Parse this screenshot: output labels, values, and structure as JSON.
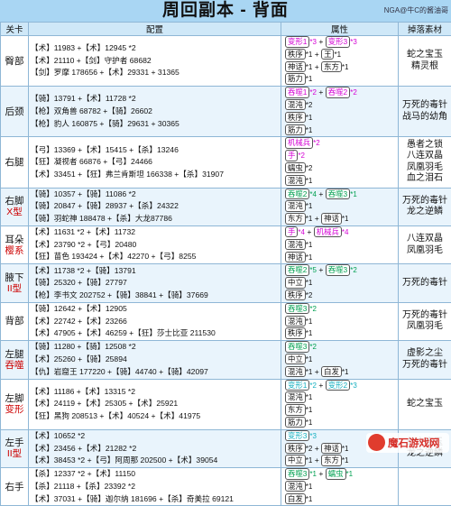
{
  "header": {
    "title": "周回副本 - 背面",
    "credit": "NGA@牛C的酱油哥"
  },
  "columns": [
    "关卡",
    "配置",
    "属性",
    "掉落素材"
  ],
  "colors": {
    "header_bg": "#a9d6f3",
    "grid": "#8fb7d6",
    "magenta": "#d400d4",
    "green": "#00a050",
    "teal": "#16b0c0",
    "tag_red": "#cc0000"
  },
  "rows": [
    {
      "pos": "臀部",
      "tag": "",
      "config": [
        "【术】11983 +【术】12945 *2",
        "【术】21110 +【剑】守护者 68682",
        "【剑】罗摩 178656 +【术】29331 + 31365"
      ],
      "attrs": [
        [
          {
            "t": "变形1",
            "c": "#d400d4"
          },
          {
            "t": "*3",
            "c": "#d400d4"
          },
          {
            "t": "变形3",
            "c": "#d400d4"
          },
          {
            "t": "*3",
            "c": "#d400d4"
          }
        ],
        [
          {
            "t": "秩序",
            "c": "#111"
          },
          {
            "t": "*1",
            "c": "#111"
          },
          {
            "t": "王",
            "c": "#111"
          },
          {
            "t": "*1",
            "c": "#111"
          }
        ],
        [
          {
            "t": "神话",
            "c": "#111"
          },
          {
            "t": "*1",
            "c": "#111"
          },
          {
            "t": "东方",
            "c": "#111"
          },
          {
            "t": "*1",
            "c": "#111"
          }
        ],
        [
          {
            "t": "筋力",
            "c": "#111"
          },
          {
            "t": "*1",
            "c": "#111"
          }
        ]
      ],
      "drops": [
        "蛇之宝玉",
        "精灵根"
      ]
    },
    {
      "pos": "后颈",
      "tag": "",
      "config": [
        "【骑】13791 +【术】11728 *2",
        "【枪】双角兽 68782 +【骑】26602",
        "【枪】豹人 160875 +【骑】29631 + 30365"
      ],
      "attrs": [
        [
          {
            "t": "吞噬1",
            "c": "#d400d4"
          },
          {
            "t": "*2",
            "c": "#d400d4"
          },
          {
            "t": "吞噬2",
            "c": "#d400d4"
          },
          {
            "t": "*2",
            "c": "#d400d4"
          }
        ],
        [
          {
            "t": "混沌",
            "c": "#111"
          },
          {
            "t": "*2",
            "c": "#111"
          }
        ],
        [
          {
            "t": "秩序",
            "c": "#111"
          },
          {
            "t": "*1",
            "c": "#111"
          }
        ],
        [
          {
            "t": "筋力",
            "c": "#111"
          },
          {
            "t": "*1",
            "c": "#111"
          }
        ]
      ],
      "drops": [
        "万死的毒针",
        "战马的幼角"
      ]
    },
    {
      "pos": "右腿",
      "tag": "",
      "config": [
        "【弓】13369 +【术】15415 +【杀】13246",
        "【狂】凝视者 66876 +【弓】24466",
        "【术】33451 +【狂】弗兰肯斯坦 166338 +【杀】31907"
      ],
      "attrs": [
        [
          {
            "t": "机械兵",
            "c": "#d400d4"
          },
          {
            "t": "*2",
            "c": "#d400d4"
          }
        ],
        [
          {
            "t": "手",
            "c": "#d400d4"
          },
          {
            "t": "*2",
            "c": "#d400d4"
          }
        ],
        [
          {
            "t": "蠕虫",
            "c": "#111"
          },
          {
            "t": "*2",
            "c": "#111"
          }
        ],
        [
          {
            "t": "混沌",
            "c": "#111"
          },
          {
            "t": "*1",
            "c": "#111"
          }
        ]
      ],
      "drops": [
        "愚者之锁",
        "八连双晶",
        "凤凰羽毛",
        "血之泪石"
      ]
    },
    {
      "pos": "右脚",
      "tag": "X型",
      "config": [
        "【骑】10357 +【骑】11086 *2",
        "【骑】20847 +【骑】28937 +【杀】24322",
        "【骑】羽蛇神 188478 +【杀】大龙87786"
      ],
      "attrs": [
        [
          {
            "t": "吞噬2",
            "c": "#00a050"
          },
          {
            "t": "*4",
            "c": "#00a050"
          },
          {
            "t": "吞噬3",
            "c": "#00a050"
          },
          {
            "t": "*1",
            "c": "#00a050"
          }
        ],
        [
          {
            "t": "混沌",
            "c": "#111"
          },
          {
            "t": "*1",
            "c": "#111"
          }
        ],
        [
          {
            "t": "东方",
            "c": "#111"
          },
          {
            "t": "*1",
            "c": "#111"
          },
          {
            "t": "神话",
            "c": "#111"
          },
          {
            "t": "*1",
            "c": "#111"
          }
        ]
      ],
      "drops": [
        "万死的毒针",
        "龙之逆鳞"
      ]
    },
    {
      "pos": "耳朵",
      "tag": "樱系",
      "config": [
        "【术】11631 *2 +【术】11732",
        "【术】23790 *2 +【弓】20480",
        "【狂】苗色 193424 +【术】42270 +【弓】8255"
      ],
      "attrs": [
        [
          {
            "t": "手",
            "c": "#d400d4"
          },
          {
            "t": "*4",
            "c": "#d400d4"
          },
          {
            "t": "机械兵",
            "c": "#d400d4"
          },
          {
            "t": "*4",
            "c": "#d400d4"
          }
        ],
        [
          {
            "t": "混沌",
            "c": "#111"
          },
          {
            "t": "*1",
            "c": "#111"
          }
        ],
        [
          {
            "t": "神话",
            "c": "#111"
          },
          {
            "t": "*1",
            "c": "#111"
          }
        ]
      ],
      "drops": [
        "八连双晶",
        "凤凰羽毛"
      ]
    },
    {
      "pos": "腋下",
      "tag": "II型",
      "config": [
        "【术】11738 *2 +【骑】13791",
        "【骑】25320 +【骑】27797",
        "【枪】李书文 202752 +【骑】38841 +【骑】37669"
      ],
      "attrs": [
        [
          {
            "t": "吞噬2",
            "c": "#00a050"
          },
          {
            "t": "*5",
            "c": "#00a050"
          },
          {
            "t": "吞噬3",
            "c": "#00a050"
          },
          {
            "t": "*2",
            "c": "#00a050"
          }
        ],
        [
          {
            "t": "中立",
            "c": "#111"
          },
          {
            "t": "*1",
            "c": "#111"
          }
        ],
        [
          {
            "t": "秩序",
            "c": "#111"
          },
          {
            "t": "*2",
            "c": "#111"
          }
        ]
      ],
      "drops": [
        "万死的毒针"
      ]
    },
    {
      "pos": "背部",
      "tag": "",
      "config": [
        "【骑】12642 +【术】12905",
        "【术】22742 +【术】23266",
        "【术】47905 +【术】46259 +【狂】莎士比亚 211530"
      ],
      "attrs": [
        [
          {
            "t": "吞噬3",
            "c": "#00a050"
          },
          {
            "t": "*2",
            "c": "#00a050"
          }
        ],
        [
          {
            "t": "混沌",
            "c": "#111"
          },
          {
            "t": "*1",
            "c": "#111"
          }
        ],
        [
          {
            "t": "秩序",
            "c": "#111"
          },
          {
            "t": "*1",
            "c": "#111"
          }
        ]
      ],
      "drops": [
        "万死的毒针",
        "凤凰羽毛"
      ]
    },
    {
      "pos": "左腿",
      "tag": "吞噬",
      "config": [
        "【骑】11280 +【骑】12508 *2",
        "【术】25260 +【骑】25894",
        "【仇】岩窟王 177220 +【骑】44740 +【骑】42097"
      ],
      "attrs": [
        [
          {
            "t": "吞噬3",
            "c": "#00a050"
          },
          {
            "t": "*2",
            "c": "#00a050"
          }
        ],
        [
          {
            "t": "中立",
            "c": "#111"
          },
          {
            "t": "*1",
            "c": "#111"
          }
        ],
        [
          {
            "t": "混沌",
            "c": "#111"
          },
          {
            "t": "*1",
            "c": "#111"
          },
          {
            "t": "白发",
            "c": "#111"
          },
          {
            "t": "*1",
            "c": "#111"
          }
        ]
      ],
      "drops": [
        "虚影之尘",
        "万死的毒针"
      ]
    },
    {
      "pos": "左脚",
      "tag": "变形",
      "config": [
        "【术】11186 +【术】13315 *2",
        "【术】24119 +【术】25305 +【术】25921",
        "【狂】黑狗 208513 +【术】40524 +【术】41975"
      ],
      "attrs": [
        [
          {
            "t": "变形1",
            "c": "#16b0c0"
          },
          {
            "t": "*2",
            "c": "#16b0c0"
          },
          {
            "t": "变形2",
            "c": "#16b0c0"
          },
          {
            "t": "*3",
            "c": "#16b0c0"
          }
        ],
        [
          {
            "t": "混沌",
            "c": "#111"
          },
          {
            "t": "*1",
            "c": "#111"
          }
        ],
        [
          {
            "t": "东方",
            "c": "#111"
          },
          {
            "t": "*1",
            "c": "#111"
          }
        ],
        [
          {
            "t": "筋力",
            "c": "#111"
          },
          {
            "t": "*1",
            "c": "#111"
          }
        ]
      ],
      "drops": [
        "蛇之宝玉"
      ]
    },
    {
      "pos": "左手",
      "tag": "II型",
      "config": [
        "【术】10652 *2",
        "【术】23456 +【术】21282 *2",
        "【术】38453 *2 +【弓】阿周那 202500 +【术】39054"
      ],
      "attrs": [
        [
          {
            "t": "变形3",
            "c": "#16b0c0"
          },
          {
            "t": "*3",
            "c": "#16b0c0"
          }
        ],
        [
          {
            "t": "秩序",
            "c": "#111"
          },
          {
            "t": "*2",
            "c": "#111"
          },
          {
            "t": "神话",
            "c": "#111"
          },
          {
            "t": "*1",
            "c": "#111"
          }
        ],
        [
          {
            "t": "中立",
            "c": "#111"
          },
          {
            "t": "*1",
            "c": "#111"
          },
          {
            "t": "东方",
            "c": "#111"
          },
          {
            "t": "*1",
            "c": "#111"
          }
        ]
      ],
      "drops": [
        "蛇之宝玉",
        "龙之逆鳞"
      ]
    },
    {
      "pos": "右手",
      "tag": "",
      "config": [
        "【杀】12337 *2 +【术】11150",
        "【杀】21118 +【杀】23392 *2",
        "【术】37031 +【骑】迦尔纳 181696 +【杀】奇美拉 69121"
      ],
      "attrs": [
        [
          {
            "t": "吞噬3",
            "c": "#00a050"
          },
          {
            "t": "*1",
            "c": "#00a050"
          },
          {
            "t": "蠕虫",
            "c": "#00a050"
          },
          {
            "t": "*1",
            "c": "#00a050"
          }
        ],
        [
          {
            "t": "混沌",
            "c": "#111"
          },
          {
            "t": "*1",
            "c": "#111"
          }
        ],
        [
          {
            "t": "白发",
            "c": "#111"
          },
          {
            "t": "*1",
            "c": "#111"
          }
        ]
      ],
      "drops": []
    }
  ],
  "watermark": {
    "text": "魔石游戏网"
  }
}
